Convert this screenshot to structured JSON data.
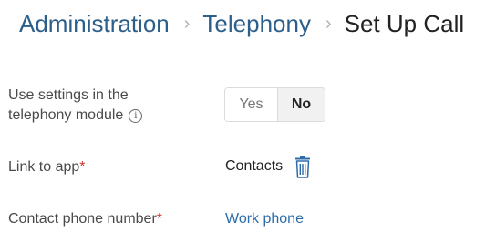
{
  "breadcrumb": {
    "items": [
      "Administration",
      "Telephony"
    ],
    "separator": "›",
    "current": "Set Up Call"
  },
  "form": {
    "use_settings": {
      "label_line1": "Use settings in the",
      "label_line2": "telephony module",
      "info_icon": "info-circle-icon",
      "options": [
        "Yes",
        "No"
      ],
      "selected": "No"
    },
    "link_to_app": {
      "label": "Link to app",
      "required_mark": "*",
      "value": "Contacts",
      "action_icon": "trash-icon"
    },
    "contact_phone": {
      "label": "Contact phone number",
      "required_mark": "*",
      "value": "Work phone"
    }
  },
  "colors": {
    "link": "#2d5f8b",
    "required": "#d2352b",
    "toggle_selected_bg": "#f1f1f1"
  }
}
